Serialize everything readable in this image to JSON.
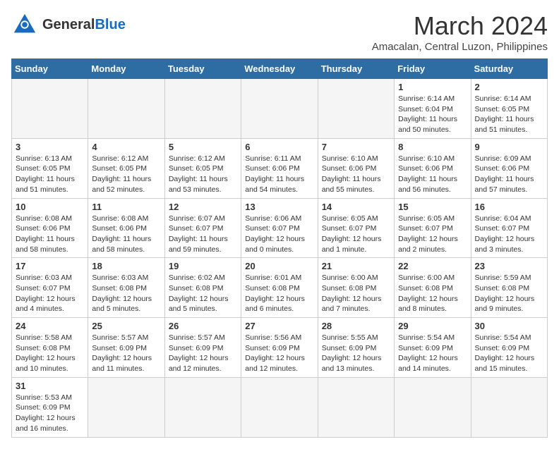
{
  "header": {
    "logo_general": "General",
    "logo_blue": "Blue",
    "month_title": "March 2024",
    "subtitle": "Amacalan, Central Luzon, Philippines"
  },
  "days_of_week": [
    "Sunday",
    "Monday",
    "Tuesday",
    "Wednesday",
    "Thursday",
    "Friday",
    "Saturday"
  ],
  "weeks": [
    [
      {
        "day": "",
        "info": "",
        "empty": true
      },
      {
        "day": "",
        "info": "",
        "empty": true
      },
      {
        "day": "",
        "info": "",
        "empty": true
      },
      {
        "day": "",
        "info": "",
        "empty": true
      },
      {
        "day": "",
        "info": "",
        "empty": true
      },
      {
        "day": "1",
        "info": "Sunrise: 6:14 AM\nSunset: 6:04 PM\nDaylight: 11 hours\nand 50 minutes."
      },
      {
        "day": "2",
        "info": "Sunrise: 6:14 AM\nSunset: 6:05 PM\nDaylight: 11 hours\nand 51 minutes."
      }
    ],
    [
      {
        "day": "3",
        "info": "Sunrise: 6:13 AM\nSunset: 6:05 PM\nDaylight: 11 hours\nand 51 minutes."
      },
      {
        "day": "4",
        "info": "Sunrise: 6:12 AM\nSunset: 6:05 PM\nDaylight: 11 hours\nand 52 minutes."
      },
      {
        "day": "5",
        "info": "Sunrise: 6:12 AM\nSunset: 6:05 PM\nDaylight: 11 hours\nand 53 minutes."
      },
      {
        "day": "6",
        "info": "Sunrise: 6:11 AM\nSunset: 6:06 PM\nDaylight: 11 hours\nand 54 minutes."
      },
      {
        "day": "7",
        "info": "Sunrise: 6:10 AM\nSunset: 6:06 PM\nDaylight: 11 hours\nand 55 minutes."
      },
      {
        "day": "8",
        "info": "Sunrise: 6:10 AM\nSunset: 6:06 PM\nDaylight: 11 hours\nand 56 minutes."
      },
      {
        "day": "9",
        "info": "Sunrise: 6:09 AM\nSunset: 6:06 PM\nDaylight: 11 hours\nand 57 minutes."
      }
    ],
    [
      {
        "day": "10",
        "info": "Sunrise: 6:08 AM\nSunset: 6:06 PM\nDaylight: 11 hours\nand 58 minutes."
      },
      {
        "day": "11",
        "info": "Sunrise: 6:08 AM\nSunset: 6:06 PM\nDaylight: 11 hours\nand 58 minutes."
      },
      {
        "day": "12",
        "info": "Sunrise: 6:07 AM\nSunset: 6:07 PM\nDaylight: 11 hours\nand 59 minutes."
      },
      {
        "day": "13",
        "info": "Sunrise: 6:06 AM\nSunset: 6:07 PM\nDaylight: 12 hours\nand 0 minutes."
      },
      {
        "day": "14",
        "info": "Sunrise: 6:05 AM\nSunset: 6:07 PM\nDaylight: 12 hours\nand 1 minute."
      },
      {
        "day": "15",
        "info": "Sunrise: 6:05 AM\nSunset: 6:07 PM\nDaylight: 12 hours\nand 2 minutes."
      },
      {
        "day": "16",
        "info": "Sunrise: 6:04 AM\nSunset: 6:07 PM\nDaylight: 12 hours\nand 3 minutes."
      }
    ],
    [
      {
        "day": "17",
        "info": "Sunrise: 6:03 AM\nSunset: 6:07 PM\nDaylight: 12 hours\nand 4 minutes."
      },
      {
        "day": "18",
        "info": "Sunrise: 6:03 AM\nSunset: 6:08 PM\nDaylight: 12 hours\nand 5 minutes."
      },
      {
        "day": "19",
        "info": "Sunrise: 6:02 AM\nSunset: 6:08 PM\nDaylight: 12 hours\nand 5 minutes."
      },
      {
        "day": "20",
        "info": "Sunrise: 6:01 AM\nSunset: 6:08 PM\nDaylight: 12 hours\nand 6 minutes."
      },
      {
        "day": "21",
        "info": "Sunrise: 6:00 AM\nSunset: 6:08 PM\nDaylight: 12 hours\nand 7 minutes."
      },
      {
        "day": "22",
        "info": "Sunrise: 6:00 AM\nSunset: 6:08 PM\nDaylight: 12 hours\nand 8 minutes."
      },
      {
        "day": "23",
        "info": "Sunrise: 5:59 AM\nSunset: 6:08 PM\nDaylight: 12 hours\nand 9 minutes."
      }
    ],
    [
      {
        "day": "24",
        "info": "Sunrise: 5:58 AM\nSunset: 6:08 PM\nDaylight: 12 hours\nand 10 minutes."
      },
      {
        "day": "25",
        "info": "Sunrise: 5:57 AM\nSunset: 6:09 PM\nDaylight: 12 hours\nand 11 minutes."
      },
      {
        "day": "26",
        "info": "Sunrise: 5:57 AM\nSunset: 6:09 PM\nDaylight: 12 hours\nand 12 minutes."
      },
      {
        "day": "27",
        "info": "Sunrise: 5:56 AM\nSunset: 6:09 PM\nDaylight: 12 hours\nand 12 minutes."
      },
      {
        "day": "28",
        "info": "Sunrise: 5:55 AM\nSunset: 6:09 PM\nDaylight: 12 hours\nand 13 minutes."
      },
      {
        "day": "29",
        "info": "Sunrise: 5:54 AM\nSunset: 6:09 PM\nDaylight: 12 hours\nand 14 minutes."
      },
      {
        "day": "30",
        "info": "Sunrise: 5:54 AM\nSunset: 6:09 PM\nDaylight: 12 hours\nand 15 minutes."
      }
    ],
    [
      {
        "day": "31",
        "info": "Sunrise: 5:53 AM\nSunset: 6:09 PM\nDaylight: 12 hours\nand 16 minutes.",
        "has_data": true
      },
      {
        "day": "",
        "info": "",
        "empty": true
      },
      {
        "day": "",
        "info": "",
        "empty": true
      },
      {
        "day": "",
        "info": "",
        "empty": true
      },
      {
        "day": "",
        "info": "",
        "empty": true
      },
      {
        "day": "",
        "info": "",
        "empty": true
      },
      {
        "day": "",
        "info": "",
        "empty": true
      }
    ]
  ]
}
